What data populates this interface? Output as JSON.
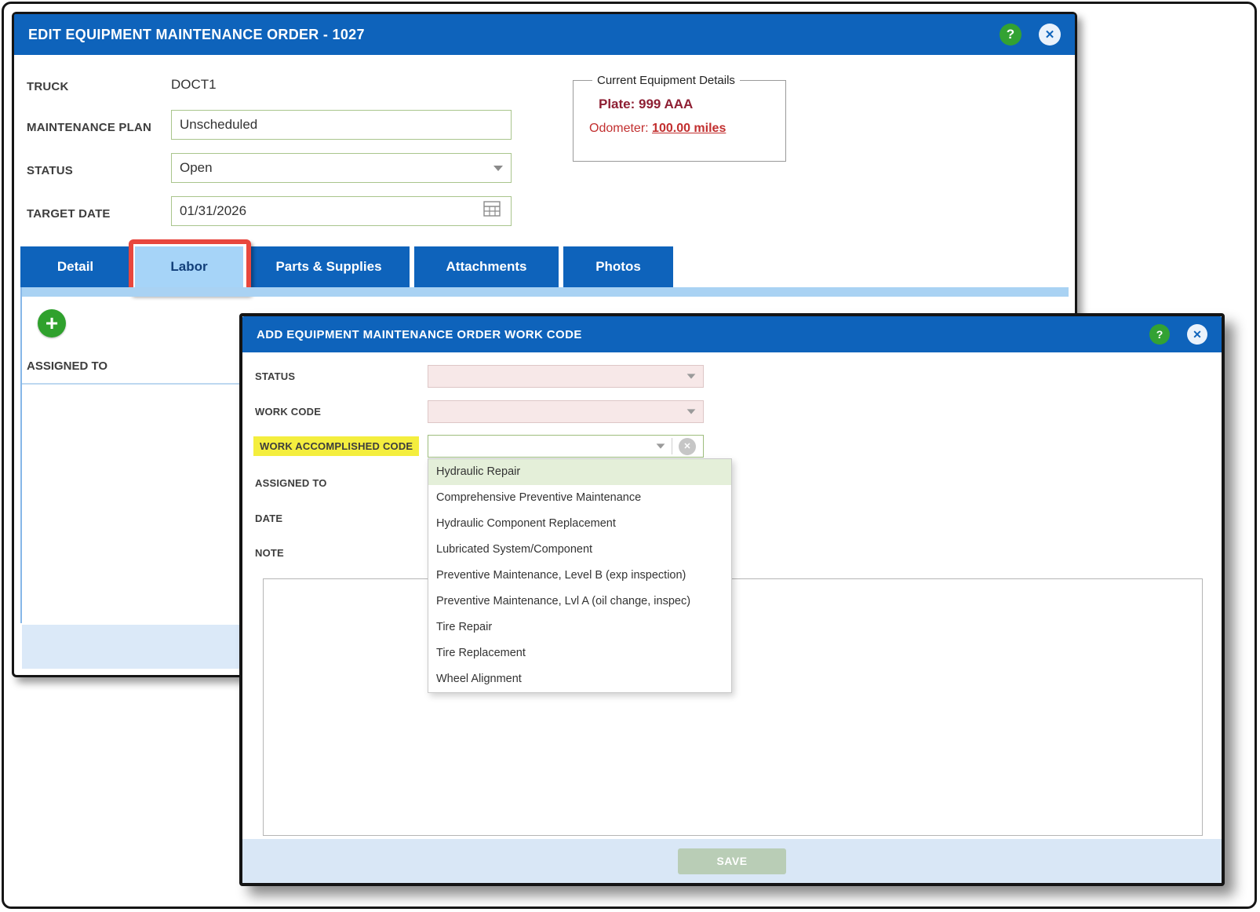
{
  "main_window": {
    "title": "EDIT EQUIPMENT MAINTENANCE ORDER - 1027",
    "help_glyph": "?",
    "close_glyph": "✕",
    "truck": {
      "label": "TRUCK",
      "value": "DOCT1"
    },
    "maintenance_plan": {
      "label": "MAINTENANCE PLAN",
      "value": "Unscheduled"
    },
    "status": {
      "label": "STATUS",
      "value": "Open"
    },
    "target_date": {
      "label": "TARGET DATE",
      "value": "01/31/2026"
    },
    "equipment_details": {
      "legend": "Current Equipment Details",
      "plate_line": "Plate: 999 AAA",
      "odometer_label": "Odometer:",
      "odometer_value": "100.00 miles"
    },
    "tabs": [
      "Detail",
      "Labor",
      "Parts & Supplies",
      "Attachments",
      "Photos"
    ],
    "labor": {
      "add_glyph": "+",
      "assigned_to_header": "ASSIGNED TO"
    }
  },
  "modal": {
    "title": "ADD EQUIPMENT MAINTENANCE ORDER WORK CODE",
    "help_glyph": "?",
    "close_glyph": "✕",
    "clear_glyph": "✕",
    "labels": {
      "status": "STATUS",
      "work_code": "WORK CODE",
      "work_accomplished_code": "WORK ACCOMPLISHED CODE",
      "assigned_to": "ASSIGNED TO",
      "date": "DATE",
      "note": "NOTE"
    },
    "dropdown_options": [
      "Hydraulic Repair",
      "Comprehensive Preventive Maintenance",
      "Hydraulic Component Replacement",
      "Lubricated System/Component",
      "Preventive Maintenance, Level B (exp inspection)",
      "Preventive Maintenance, Lvl A (oil change, inspec)",
      "Tire Repair",
      "Tire Replacement",
      "Wheel Alignment"
    ],
    "save_label": "SAVE"
  },
  "colors": {
    "titlebar_blue": "#0e63bb",
    "active_tab_blue": "#a6d4f8",
    "annotation_red": "#e8473e",
    "plate_red": "#8e1f33",
    "odometer_red": "#c22f2f",
    "highlight_yellow": "#f4ee3e",
    "selected_option_green": "#e4efd9",
    "add_button_green": "#2fa12d",
    "save_button_green": "#b9cdb6"
  }
}
